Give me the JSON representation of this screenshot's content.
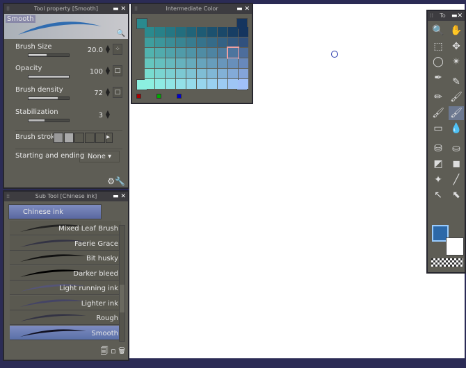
{
  "tool_property": {
    "title": "Tool property [Smooth]",
    "preview_label": "Smooth",
    "props": [
      {
        "label": "Brush Size",
        "value": "20.0",
        "fill": 0.45,
        "icon": "brush-shape-icon"
      },
      {
        "label": "Opacity",
        "value": "100",
        "fill": 1.0,
        "icon": "pressure-icon"
      },
      {
        "label": "Brush density",
        "value": "72",
        "fill": 0.72,
        "icon": "pressure-icon"
      },
      {
        "label": "Stabilization",
        "value": "3",
        "fill": 0.4
      }
    ],
    "brush_stroke_label": "Brush stroke",
    "start_end_label": "Starting and ending",
    "start_end_value": "None"
  },
  "sub_tool": {
    "title": "Sub Tool [Chinese ink]",
    "group": "Chinese ink",
    "items": [
      "Mixed Leaf Brush",
      "Faerie Grace",
      "Bit husky",
      "Darker bleed",
      "Light running ink",
      "Lighter ink",
      "Rough",
      "Smooth"
    ],
    "selected": "Smooth"
  },
  "intermediate_color": {
    "title": "Intermediate Color",
    "corners": {
      "tl": "#2a8a8e",
      "tr": "#15355f",
      "bl": "#8cf0e0",
      "br": "#a0c0f8"
    },
    "rows": 6,
    "cols": 10,
    "selected_row": 2,
    "selected_col": 8
  },
  "toolbox": {
    "title": "To",
    "main_color": "#2c68a8",
    "sub_color": "#ffffff"
  }
}
